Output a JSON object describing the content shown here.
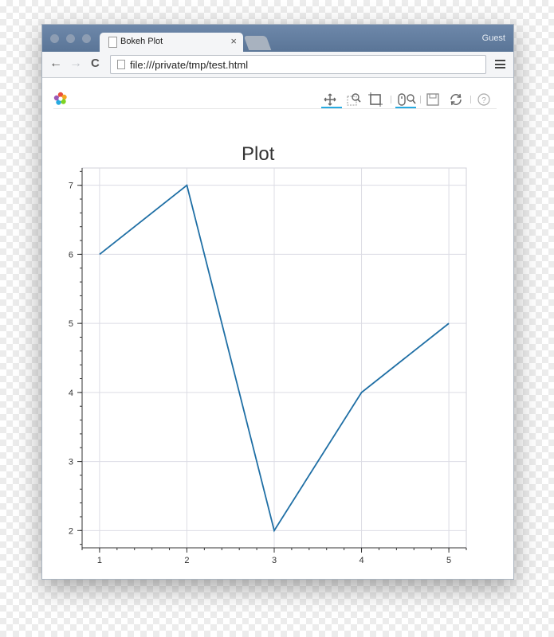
{
  "browser": {
    "tab_title": "Bokeh Plot",
    "tab_close": "×",
    "user_label": "Guest",
    "url": "file:///private/tmp/test.html",
    "back_glyph": "←",
    "forward_glyph": "→",
    "reload_glyph": "C"
  },
  "icons": {
    "logo": "bokeh-logo-icon",
    "pan": "pan-icon",
    "box_zoom": "box-zoom-icon",
    "resize": "resize-icon",
    "wheel_zoom": "wheel-zoom-icon",
    "save": "save-icon",
    "reset": "reset-icon",
    "help": "help-icon",
    "help_glyph": "?"
  },
  "colors": {
    "line": "#1f6fa5",
    "active_tool": "#26aae1",
    "titlebar": "#5f7a9c"
  },
  "chart_data": {
    "type": "line",
    "title": "Plot",
    "x": [
      1,
      2,
      3,
      4,
      5
    ],
    "series": [
      {
        "values": [
          6,
          7,
          2,
          4,
          5
        ]
      }
    ],
    "xlim": [
      0.8,
      5.2
    ],
    "ylim": [
      1.75,
      7.25
    ],
    "x_ticks": [
      1,
      2,
      3,
      4,
      5
    ],
    "y_ticks": [
      2,
      3,
      4,
      5,
      6,
      7
    ],
    "xlabel": "",
    "ylabel": "",
    "grid": true
  }
}
